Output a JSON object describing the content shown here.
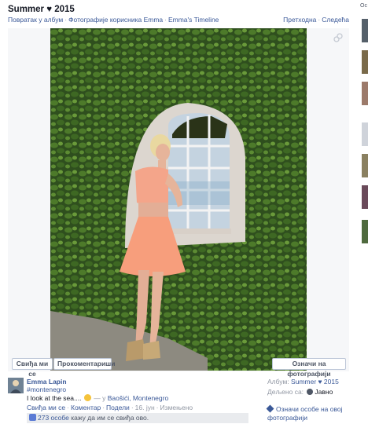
{
  "album": {
    "title": "Summer ♥ 2015"
  },
  "breadcrumbs": [
    "Повратак у албум",
    "Фотографије корисника Emma",
    "Emma's Timeline"
  ],
  "pager": {
    "prev": "Претходна",
    "next": "Следећа"
  },
  "photo_actions": {
    "like": "Свиђа ми се",
    "comment": "Прокоментариши",
    "tag": "Означи на фотографији"
  },
  "post": {
    "author": "Emma Lapin",
    "hashtag": "#montenegro",
    "caption_text": "I look at the sea....",
    "caption_mid": " — у ",
    "location": "Baošići, Montenegro",
    "actions": [
      "Свиђа ми се",
      "Коментар",
      "Подели"
    ],
    "date": "16. јун",
    "edited": "Измењено",
    "likes_count": "273 особе",
    "likes_rest": " кажу да им се свиђа ово."
  },
  "meta": {
    "album_label": "Албум: ",
    "album_value": "Summer ♥ 2015",
    "shared_label": "Дељено са: ",
    "shared_value": "Јавно",
    "tag_people": "Означи особе на овој фотографији"
  },
  "side": {
    "header": "Ос"
  },
  "colors": {
    "link": "#3b5998",
    "muted": "#9197a3",
    "border": "#bdc7d8",
    "stage": "#f6f7f9"
  },
  "icons": [
    "expand-icon",
    "smile-icon",
    "globe-icon",
    "thumbs-up-icon",
    "tag-icon"
  ]
}
